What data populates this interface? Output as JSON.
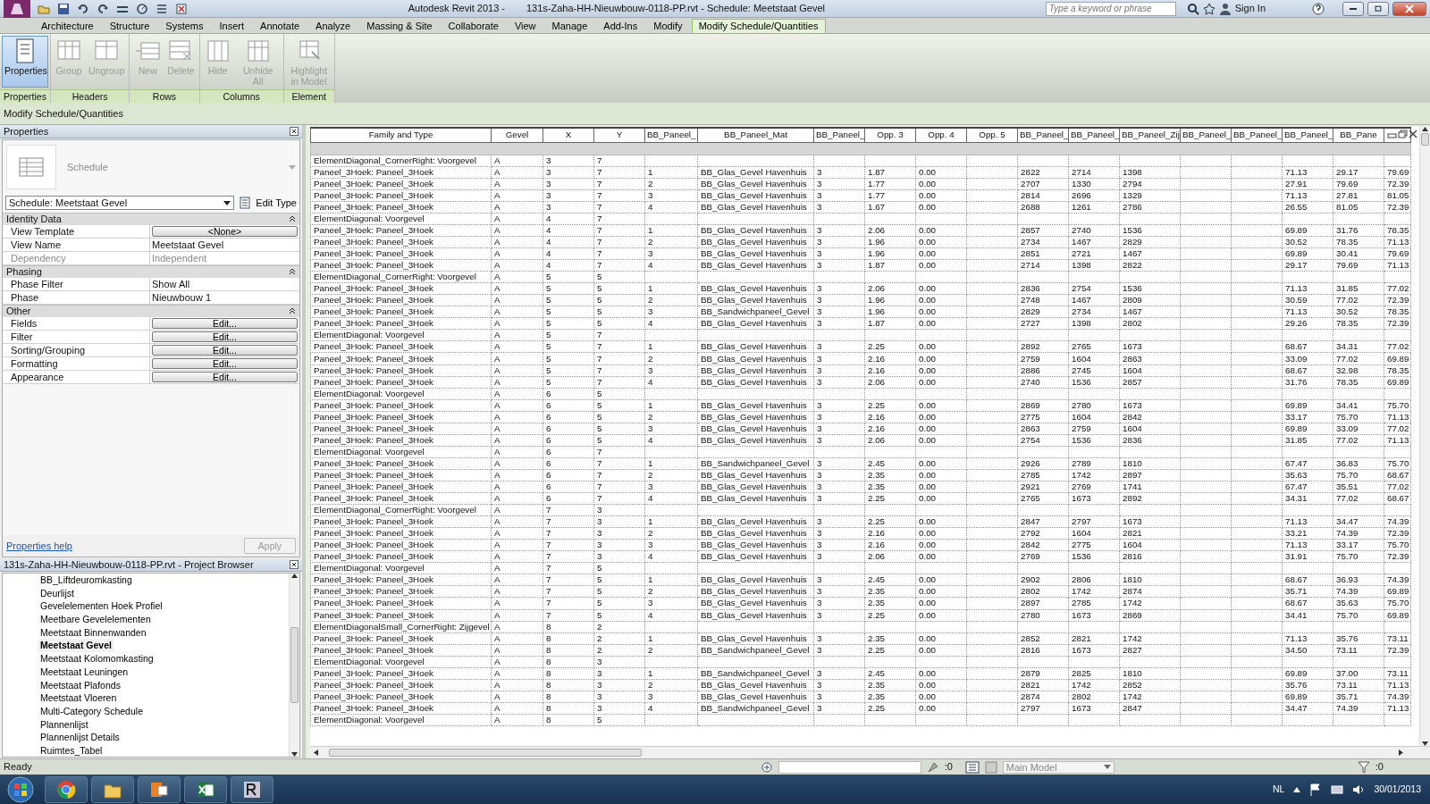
{
  "window": {
    "app_name": "Autodesk Revit 2013 -",
    "document": "131s-Zaha-HH-Nieuwbouw-0118-PP.rvt - Schedule: Meetstaat Gevel"
  },
  "search": {
    "placeholder": "Type a keyword or phrase"
  },
  "sign_in": "Sign In",
  "ribbon_tabs": [
    {
      "label": "Architecture",
      "selected": false
    },
    {
      "label": "Structure",
      "selected": false
    },
    {
      "label": "Systems",
      "selected": false
    },
    {
      "label": "Insert",
      "selected": false
    },
    {
      "label": "Annotate",
      "selected": false
    },
    {
      "label": "Analyze",
      "selected": false
    },
    {
      "label": "Massing & Site",
      "selected": false
    },
    {
      "label": "Collaborate",
      "selected": false
    },
    {
      "label": "View",
      "selected": false
    },
    {
      "label": "Manage",
      "selected": false
    },
    {
      "label": "Add-Ins",
      "selected": false
    },
    {
      "label": "Modify",
      "selected": false
    },
    {
      "label": "Modify Schedule/Quantities",
      "selected": true
    }
  ],
  "ribbon_panels": [
    {
      "title": "Properties",
      "buttons": [
        {
          "label": "Properties",
          "kind": "properties",
          "disabled": false,
          "on": true
        }
      ]
    },
    {
      "title": "Headers",
      "buttons": [
        {
          "label": "Group",
          "kind": "group",
          "disabled": true,
          "on": false
        },
        {
          "label": "Ungroup",
          "kind": "ungroup",
          "disabled": true,
          "on": false
        }
      ]
    },
    {
      "title": "Rows",
      "buttons": [
        {
          "label": "New",
          "kind": "new",
          "disabled": true,
          "on": false
        },
        {
          "label": "Delete",
          "kind": "delete",
          "disabled": true,
          "on": false
        }
      ]
    },
    {
      "title": "Columns",
      "buttons": [
        {
          "label": "Hide",
          "kind": "hide",
          "disabled": true,
          "on": false
        },
        {
          "label": "Unhide All",
          "kind": "unhide",
          "disabled": true,
          "on": false
        }
      ]
    },
    {
      "title": "Element",
      "buttons": [
        {
          "label": "Highlight in Model",
          "kind": "highlight",
          "disabled": true,
          "on": false
        }
      ]
    }
  ],
  "options_bar": "Modify Schedule/Quantities",
  "properties": {
    "title": "Properties",
    "type_name": "Schedule",
    "view_selector": "Schedule: Meetstaat Gevel",
    "edit_type": "Edit Type",
    "groups": [
      {
        "name": "Identity Data",
        "expanded": true,
        "rows": [
          {
            "label": "View Template",
            "value": "<None>",
            "kind": "button",
            "disabled": false
          },
          {
            "label": "View Name",
            "value": "Meetstaat Gevel",
            "kind": "text",
            "disabled": false
          },
          {
            "label": "Dependency",
            "value": "Independent",
            "kind": "text",
            "disabled": true
          }
        ]
      },
      {
        "name": "Phasing",
        "expanded": true,
        "rows": [
          {
            "label": "Phase Filter",
            "value": "Show All",
            "kind": "text",
            "disabled": false
          },
          {
            "label": "Phase",
            "value": "Nieuwbouw 1",
            "kind": "text",
            "disabled": false
          }
        ]
      },
      {
        "name": "Other",
        "expanded": true,
        "rows": [
          {
            "label": "Fields",
            "value": "Edit...",
            "kind": "button",
            "disabled": false
          },
          {
            "label": "Filter",
            "value": "Edit...",
            "kind": "button",
            "disabled": false
          },
          {
            "label": "Sorting/Grouping",
            "value": "Edit...",
            "kind": "button",
            "disabled": false
          },
          {
            "label": "Formatting",
            "value": "Edit...",
            "kind": "button",
            "disabled": false
          },
          {
            "label": "Appearance",
            "value": "Edit...",
            "kind": "button",
            "disabled": false
          }
        ]
      }
    ],
    "help_link": "Properties help",
    "apply": {
      "label": "Apply",
      "disabled": true
    }
  },
  "project_browser": {
    "title": "131s-Zaha-HH-Nieuwbouw-0118-PP.rvt - Project Browser",
    "items": [
      {
        "label": "BB_Liftdeuromkasting",
        "selected": false
      },
      {
        "label": "Deurlijst",
        "selected": false
      },
      {
        "label": "Gevelelementen Hoek Profiel",
        "selected": false
      },
      {
        "label": "Meetbare Gevelelementen",
        "selected": false
      },
      {
        "label": "Meetstaat Binnenwanden",
        "selected": false
      },
      {
        "label": "Meetstaat Gevel",
        "selected": true
      },
      {
        "label": "Meetstaat Kolomomkasting",
        "selected": false
      },
      {
        "label": "Meetstaat Leuningen",
        "selected": false
      },
      {
        "label": "Meetstaat Plafonds",
        "selected": false
      },
      {
        "label": "Meetstaat Vloeren",
        "selected": false
      },
      {
        "label": "Multi-Category Schedule",
        "selected": false
      },
      {
        "label": "Plannenlijst",
        "selected": false
      },
      {
        "label": "Plannenlijst Details",
        "selected": false
      },
      {
        "label": "Ruimtes_Tabel",
        "selected": false
      }
    ]
  },
  "schedule": {
    "columns": [
      "Family and Type",
      "Gevel",
      "X",
      "Y",
      "BB_Paneel_",
      "BB_Paneel_Mat",
      "BB_Paneel_",
      "Opp. 3",
      "Opp. 4",
      "Opp. 5",
      "BB_Paneel_",
      "BB_Paneel_",
      "BB_Paneel_Zij",
      "BB_Paneel_",
      "BB_Paneel_",
      "BB_Paneel_",
      "BB_Pane",
      null
    ],
    "rows": [
      [
        "ElementDiagonal_CornerRight: Voorgevel",
        "A",
        "3",
        "7",
        null,
        null,
        null,
        null,
        null,
        null,
        null,
        null,
        null,
        null,
        null,
        null,
        null,
        null
      ],
      [
        "Paneel_3Hoek: Paneel_3Hoek",
        "A",
        "3",
        "7",
        "1",
        "BB_Glas_Gevel Havenhuis",
        "3",
        "1.87",
        "0.00",
        null,
        "2822",
        "2714",
        "1398",
        null,
        null,
        "71.13",
        "29.17",
        "79.69"
      ],
      [
        "Paneel_3Hoek: Paneel_3Hoek",
        "A",
        "3",
        "7",
        "2",
        "BB_Glas_Gevel Havenhuis",
        "3",
        "1.77",
        "0.00",
        null,
        "2707",
        "1330",
        "2794",
        null,
        null,
        "27.91",
        "79.69",
        "72.39"
      ],
      [
        "Paneel_3Hoek: Paneel_3Hoek",
        "A",
        "3",
        "7",
        "3",
        "BB_Glas_Gevel Havenhuis",
        "3",
        "1.77",
        "0.00",
        null,
        "2814",
        "2696",
        "1329",
        null,
        null,
        "71.13",
        "27.81",
        "81.05"
      ],
      [
        "Paneel_3Hoek: Paneel_3Hoek",
        "A",
        "3",
        "7",
        "4",
        "BB_Glas_Gevel Havenhuis",
        "3",
        "1.67",
        "0.00",
        null,
        "2688",
        "1261",
        "2786",
        null,
        null,
        "26.55",
        "81.05",
        "72.39"
      ],
      [
        "ElementDiagonal: Voorgevel",
        "A",
        "4",
        "7",
        null,
        null,
        null,
        null,
        null,
        null,
        null,
        null,
        null,
        null,
        null,
        null,
        null,
        null
      ],
      [
        "Paneel_3Hoek: Paneel_3Hoek",
        "A",
        "4",
        "7",
        "1",
        "BB_Glas_Gevel Havenhuis",
        "3",
        "2.06",
        "0.00",
        null,
        "2857",
        "2740",
        "1536",
        null,
        null,
        "69.89",
        "31.76",
        "78.35"
      ],
      [
        "Paneel_3Hoek: Paneel_3Hoek",
        "A",
        "4",
        "7",
        "2",
        "BB_Glas_Gevel Havenhuis",
        "3",
        "1.96",
        "0.00",
        null,
        "2734",
        "1467",
        "2829",
        null,
        null,
        "30.52",
        "78.35",
        "71.13"
      ],
      [
        "Paneel_3Hoek: Paneel_3Hoek",
        "A",
        "4",
        "7",
        "3",
        "BB_Glas_Gevel Havenhuis",
        "3",
        "1.96",
        "0.00",
        null,
        "2851",
        "2721",
        "1467",
        null,
        null,
        "69.89",
        "30.41",
        "79.69"
      ],
      [
        "Paneel_3Hoek: Paneel_3Hoek",
        "A",
        "4",
        "7",
        "4",
        "BB_Glas_Gevel Havenhuis",
        "3",
        "1.87",
        "0.00",
        null,
        "2714",
        "1398",
        "2822",
        null,
        null,
        "29.17",
        "79.69",
        "71.13"
      ],
      [
        "ElementDiagonal_CornerRight: Voorgevel",
        "A",
        "5",
        "5",
        null,
        null,
        null,
        null,
        null,
        null,
        null,
        null,
        null,
        null,
        null,
        null,
        null,
        null
      ],
      [
        "Paneel_3Hoek: Paneel_3Hoek",
        "A",
        "5",
        "5",
        "1",
        "BB_Glas_Gevel Havenhuis",
        "3",
        "2.06",
        "0.00",
        null,
        "2836",
        "2754",
        "1536",
        null,
        null,
        "71.13",
        "31.85",
        "77.02"
      ],
      [
        "Paneel_3Hoek: Paneel_3Hoek",
        "A",
        "5",
        "5",
        "2",
        "BB_Glas_Gevel Havenhuis",
        "3",
        "1.96",
        "0.00",
        null,
        "2748",
        "1467",
        "2809",
        null,
        null,
        "30.59",
        "77.02",
        "72.39"
      ],
      [
        "Paneel_3Hoek: Paneel_3Hoek",
        "A",
        "5",
        "5",
        "3",
        "BB_Sandwichpaneel_Gevel",
        "3",
        "1.96",
        "0.00",
        null,
        "2829",
        "2734",
        "1467",
        null,
        null,
        "71.13",
        "30.52",
        "78.35"
      ],
      [
        "Paneel_3Hoek: Paneel_3Hoek",
        "A",
        "5",
        "5",
        "4",
        "BB_Glas_Gevel Havenhuis",
        "3",
        "1.87",
        "0.00",
        null,
        "2727",
        "1398",
        "2802",
        null,
        null,
        "29.26",
        "78.35",
        "72.39"
      ],
      [
        "ElementDiagonal: Voorgevel",
        "A",
        "5",
        "7",
        null,
        null,
        null,
        null,
        null,
        null,
        null,
        null,
        null,
        null,
        null,
        null,
        null,
        null
      ],
      [
        "Paneel_3Hoek: Paneel_3Hoek",
        "A",
        "5",
        "7",
        "1",
        "BB_Glas_Gevel Havenhuis",
        "3",
        "2.25",
        "0.00",
        null,
        "2892",
        "2765",
        "1673",
        null,
        null,
        "68.67",
        "34.31",
        "77.02"
      ],
      [
        "Paneel_3Hoek: Paneel_3Hoek",
        "A",
        "5",
        "7",
        "2",
        "BB_Glas_Gevel Havenhuis",
        "3",
        "2.16",
        "0.00",
        null,
        "2759",
        "1604",
        "2863",
        null,
        null,
        "33.09",
        "77.02",
        "69.89"
      ],
      [
        "Paneel_3Hoek: Paneel_3Hoek",
        "A",
        "5",
        "7",
        "3",
        "BB_Glas_Gevel Havenhuis",
        "3",
        "2.16",
        "0.00",
        null,
        "2886",
        "2745",
        "1604",
        null,
        null,
        "68.67",
        "32.98",
        "78.35"
      ],
      [
        "Paneel_3Hoek: Paneel_3Hoek",
        "A",
        "5",
        "7",
        "4",
        "BB_Glas_Gevel Havenhuis",
        "3",
        "2.06",
        "0.00",
        null,
        "2740",
        "1536",
        "2857",
        null,
        null,
        "31.76",
        "78.35",
        "69.89"
      ],
      [
        "ElementDiagonal: Voorgevel",
        "A",
        "6",
        "5",
        null,
        null,
        null,
        null,
        null,
        null,
        null,
        null,
        null,
        null,
        null,
        null,
        null,
        null
      ],
      [
        "Paneel_3Hoek: Paneel_3Hoek",
        "A",
        "6",
        "5",
        "1",
        "BB_Glas_Gevel Havenhuis",
        "3",
        "2.25",
        "0.00",
        null,
        "2869",
        "2780",
        "1673",
        null,
        null,
        "69.89",
        "34.41",
        "75.70"
      ],
      [
        "Paneel_3Hoek: Paneel_3Hoek",
        "A",
        "6",
        "5",
        "2",
        "BB_Glas_Gevel Havenhuis",
        "3",
        "2.16",
        "0.00",
        null,
        "2775",
        "1604",
        "2842",
        null,
        null,
        "33.17",
        "75.70",
        "71.13"
      ],
      [
        "Paneel_3Hoek: Paneel_3Hoek",
        "A",
        "6",
        "5",
        "3",
        "BB_Glas_Gevel Havenhuis",
        "3",
        "2.16",
        "0.00",
        null,
        "2863",
        "2759",
        "1604",
        null,
        null,
        "69.89",
        "33.09",
        "77.02"
      ],
      [
        "Paneel_3Hoek: Paneel_3Hoek",
        "A",
        "6",
        "5",
        "4",
        "BB_Glas_Gevel Havenhuis",
        "3",
        "2.06",
        "0.00",
        null,
        "2754",
        "1536",
        "2836",
        null,
        null,
        "31.85",
        "77.02",
        "71.13"
      ],
      [
        "ElementDiagonal: Voorgevel",
        "A",
        "6",
        "7",
        null,
        null,
        null,
        null,
        null,
        null,
        null,
        null,
        null,
        null,
        null,
        null,
        null,
        null
      ],
      [
        "Paneel_3Hoek: Paneel_3Hoek",
        "A",
        "6",
        "7",
        "1",
        "BB_Sandwichpaneel_Gevel",
        "3",
        "2.45",
        "0.00",
        null,
        "2926",
        "2789",
        "1810",
        null,
        null,
        "67.47",
        "36.83",
        "75.70"
      ],
      [
        "Paneel_3Hoek: Paneel_3Hoek",
        "A",
        "6",
        "7",
        "2",
        "BB_Glas_Gevel Havenhuis",
        "3",
        "2.35",
        "0.00",
        null,
        "2785",
        "1742",
        "2897",
        null,
        null,
        "35.63",
        "75.70",
        "68.67"
      ],
      [
        "Paneel_3Hoek: Paneel_3Hoek",
        "A",
        "6",
        "7",
        "3",
        "BB_Glas_Gevel Havenhuis",
        "3",
        "2.35",
        "0.00",
        null,
        "2921",
        "2769",
        "1741",
        null,
        null,
        "67.47",
        "35.51",
        "77.02"
      ],
      [
        "Paneel_3Hoek: Paneel_3Hoek",
        "A",
        "6",
        "7",
        "4",
        "BB_Glas_Gevel Havenhuis",
        "3",
        "2.25",
        "0.00",
        null,
        "2765",
        "1673",
        "2892",
        null,
        null,
        "34.31",
        "77.02",
        "68.67"
      ],
      [
        "ElementDiagonal_CornerRight: Voorgevel",
        "A",
        "7",
        "3",
        null,
        null,
        null,
        null,
        null,
        null,
        null,
        null,
        null,
        null,
        null,
        null,
        null,
        null
      ],
      [
        "Paneel_3Hoek: Paneel_3Hoek",
        "A",
        "7",
        "3",
        "1",
        "BB_Glas_Gevel Havenhuis",
        "3",
        "2.25",
        "0.00",
        null,
        "2847",
        "2797",
        "1673",
        null,
        null,
        "71.13",
        "34.47",
        "74.39"
      ],
      [
        "Paneel_3Hoek: Paneel_3Hoek",
        "A",
        "7",
        "3",
        "2",
        "BB_Glas_Gevel Havenhuis",
        "3",
        "2.16",
        "0.00",
        null,
        "2792",
        "1604",
        "2821",
        null,
        null,
        "33.21",
        "74.39",
        "72.39"
      ],
      [
        "Paneel_3Hoek: Paneel_3Hoek",
        "A",
        "7",
        "3",
        "3",
        "BB_Glas_Gevel Havenhuis",
        "3",
        "2.16",
        "0.00",
        null,
        "2842",
        "2775",
        "1604",
        null,
        null,
        "71.13",
        "33.17",
        "75.70"
      ],
      [
        "Paneel_3Hoek: Paneel_3Hoek",
        "A",
        "7",
        "3",
        "4",
        "BB_Glas_Gevel Havenhuis",
        "3",
        "2.06",
        "0.00",
        null,
        "2769",
        "1536",
        "2816",
        null,
        null,
        "31.91",
        "75.70",
        "72.39"
      ],
      [
        "ElementDiagonal: Voorgevel",
        "A",
        "7",
        "5",
        null,
        null,
        null,
        null,
        null,
        null,
        null,
        null,
        null,
        null,
        null,
        null,
        null,
        null
      ],
      [
        "Paneel_3Hoek: Paneel_3Hoek",
        "A",
        "7",
        "5",
        "1",
        "BB_Glas_Gevel Havenhuis",
        "3",
        "2.45",
        "0.00",
        null,
        "2902",
        "2806",
        "1810",
        null,
        null,
        "68.67",
        "36.93",
        "74.39"
      ],
      [
        "Paneel_3Hoek: Paneel_3Hoek",
        "A",
        "7",
        "5",
        "2",
        "BB_Glas_Gevel Havenhuis",
        "3",
        "2.35",
        "0.00",
        null,
        "2802",
        "1742",
        "2874",
        null,
        null,
        "35.71",
        "74.39",
        "69.89"
      ],
      [
        "Paneel_3Hoek: Paneel_3Hoek",
        "A",
        "7",
        "5",
        "3",
        "BB_Glas_Gevel Havenhuis",
        "3",
        "2.35",
        "0.00",
        null,
        "2897",
        "2785",
        "1742",
        null,
        null,
        "68.67",
        "35.63",
        "75.70"
      ],
      [
        "Paneel_3Hoek: Paneel_3Hoek",
        "A",
        "7",
        "5",
        "4",
        "BB_Glas_Gevel Havenhuis",
        "3",
        "2.25",
        "0.00",
        null,
        "2780",
        "1673",
        "2869",
        null,
        null,
        "34.41",
        "75.70",
        "69.89"
      ],
      [
        "ElementDiagonalSmall_CornerRight: Zijgevel",
        "A",
        "8",
        "2",
        null,
        null,
        null,
        null,
        null,
        null,
        null,
        null,
        null,
        null,
        null,
        null,
        null,
        null
      ],
      [
        "Paneel_3Hoek: Paneel_3Hoek",
        "A",
        "8",
        "2",
        "1",
        "BB_Glas_Gevel Havenhuis",
        "3",
        "2.35",
        "0.00",
        null,
        "2852",
        "2821",
        "1742",
        null,
        null,
        "71.13",
        "35.76",
        "73.11"
      ],
      [
        "Paneel_3Hoek: Paneel_3Hoek",
        "A",
        "8",
        "2",
        "2",
        "BB_Sandwichpaneel_Gevel",
        "3",
        "2.25",
        "0.00",
        null,
        "2816",
        "1673",
        "2827",
        null,
        null,
        "34.50",
        "73.11",
        "72.39"
      ],
      [
        "ElementDiagonal: Voorgevel",
        "A",
        "8",
        "3",
        null,
        null,
        null,
        null,
        null,
        null,
        null,
        null,
        null,
        null,
        null,
        null,
        null,
        null
      ],
      [
        "Paneel_3Hoek: Paneel_3Hoek",
        "A",
        "8",
        "3",
        "1",
        "BB_Sandwichpaneel_Gevel",
        "3",
        "2.45",
        "0.00",
        null,
        "2879",
        "2825",
        "1810",
        null,
        null,
        "69.89",
        "37.00",
        "73.11"
      ],
      [
        "Paneel_3Hoek: Paneel_3Hoek",
        "A",
        "8",
        "3",
        "2",
        "BB_Glas_Gevel Havenhuis",
        "3",
        "2.35",
        "0.00",
        null,
        "2821",
        "1742",
        "2852",
        null,
        null,
        "35.76",
        "73.11",
        "71.13"
      ],
      [
        "Paneel_3Hoek: Paneel_3Hoek",
        "A",
        "8",
        "3",
        "3",
        "BB_Glas_Gevel Havenhuis",
        "3",
        "2.35",
        "0.00",
        null,
        "2874",
        "2802",
        "1742",
        null,
        null,
        "69.89",
        "35.71",
        "74.39"
      ],
      [
        "Paneel_3Hoek: Paneel_3Hoek",
        "A",
        "8",
        "3",
        "4",
        "BB_Sandwichpaneel_Gevel",
        "3",
        "2.25",
        "0.00",
        null,
        "2797",
        "1673",
        "2847",
        null,
        null,
        "34.47",
        "74.39",
        "71.13"
      ],
      [
        "ElementDiagonal: Voorgevel",
        "A",
        "8",
        "5",
        null,
        null,
        null,
        null,
        null,
        null,
        null,
        null,
        null,
        null,
        null,
        null,
        null,
        null
      ]
    ]
  },
  "status_bar": {
    "text": "Ready",
    "worksets_count": ":0",
    "model": "Main Model",
    "filter_count": ":0"
  },
  "taskbar": {
    "language": "NL",
    "date": "30/01/2013"
  }
}
